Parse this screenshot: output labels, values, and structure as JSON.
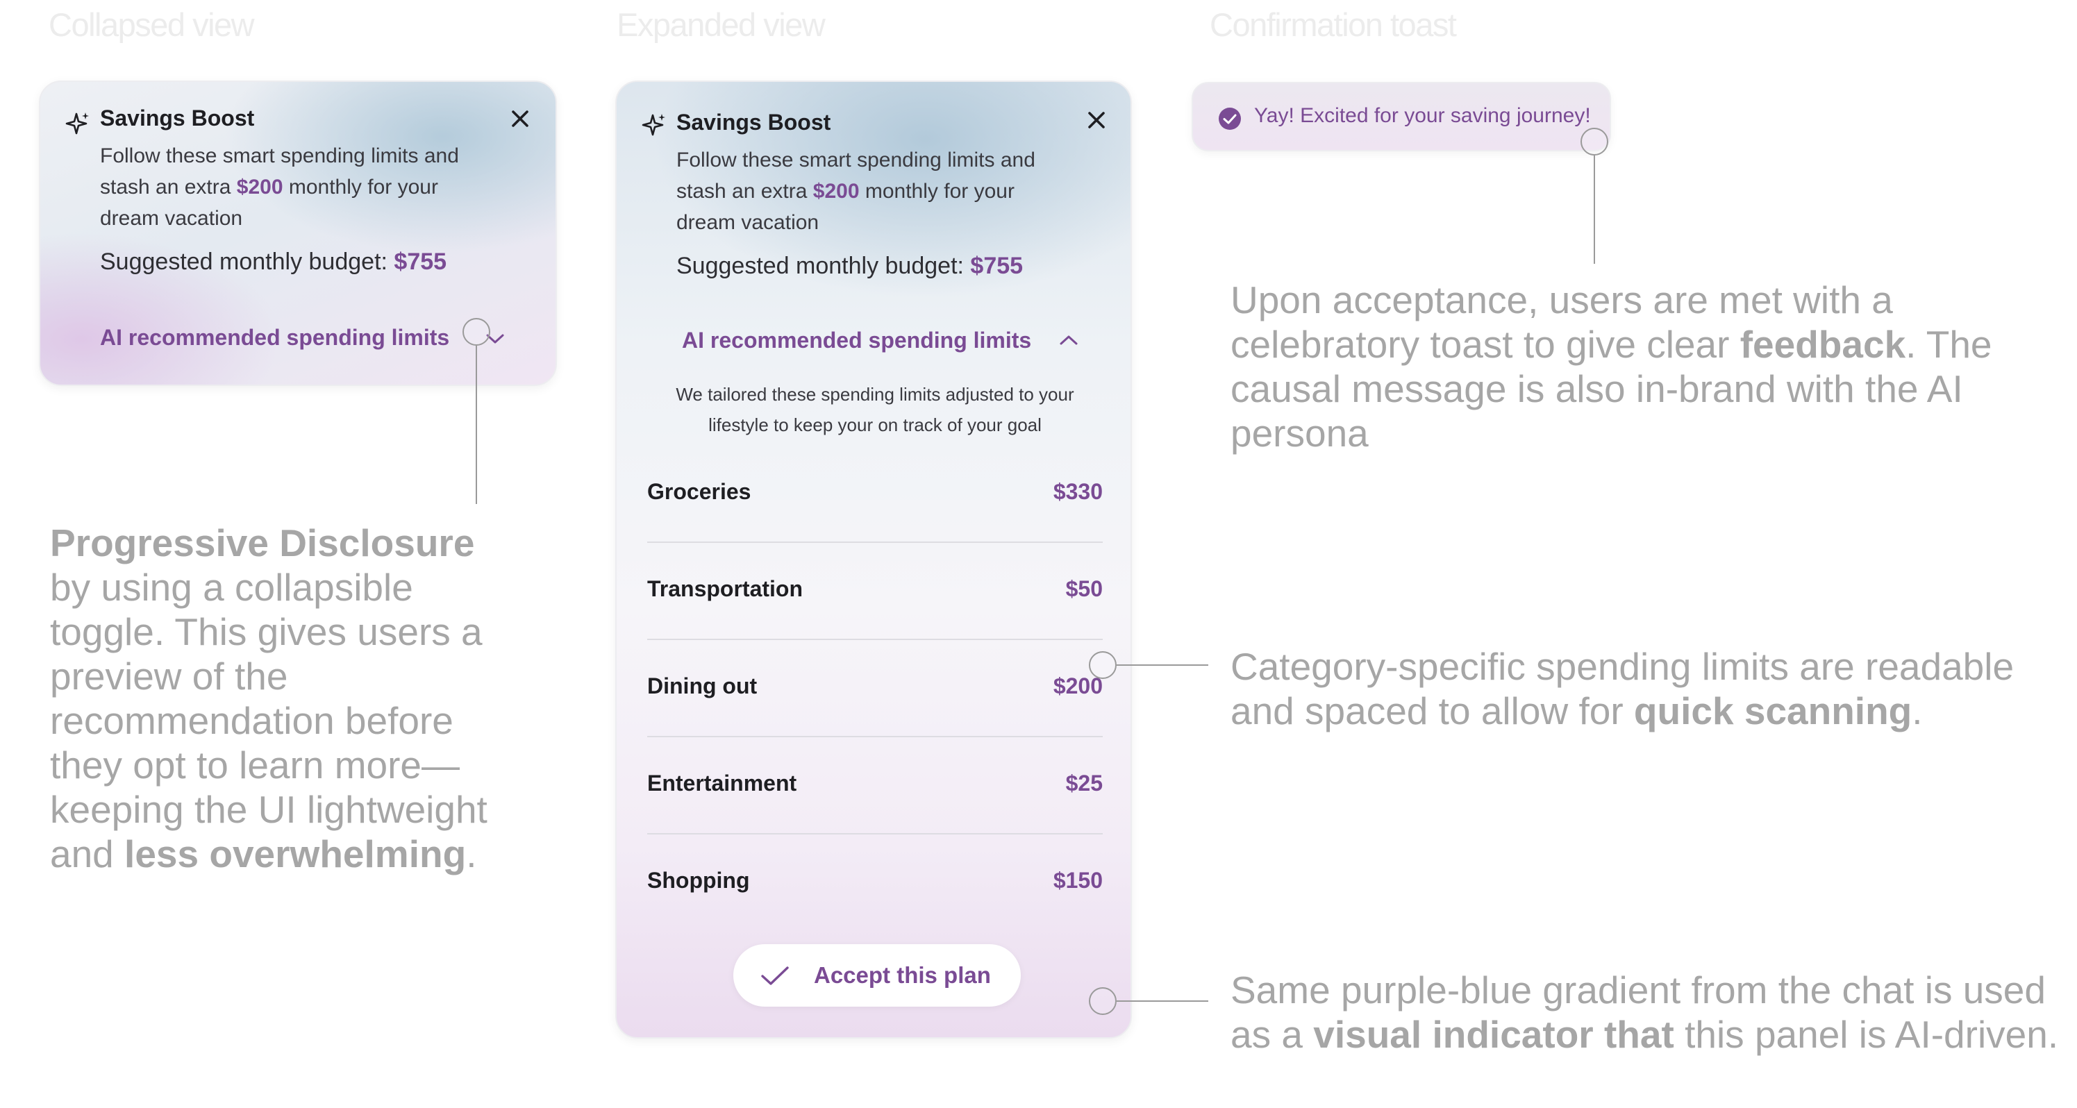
{
  "headings": {
    "collapsed": "Collapsed view",
    "expanded": "Expanded view",
    "toast": "Confirmation toast"
  },
  "card": {
    "title": "Savings Boost",
    "desc_pre": "Follow these smart spending limits and stash an extra ",
    "desc_amount": "$200",
    "desc_post": " monthly for your dream vacation",
    "desc_line1": "Follow these smart spending limits and",
    "desc_line2_a": "stash an extra ",
    "desc_line2_b": " monthly for your",
    "desc_line3": "dream vacation",
    "budget_label": "Suggested monthly budget: ",
    "budget_value": "$755",
    "limits_label": "AI recommended spending limits",
    "tailored_line1": "We tailored these spending limits adjusted to your",
    "tailored_line2": "lifestyle to keep your on track of your goal",
    "categories": [
      {
        "label": "Groceries",
        "value": "$330"
      },
      {
        "label": "Transportation",
        "value": "$50"
      },
      {
        "label": "Dining out",
        "value": "$200"
      },
      {
        "label": "Entertainment",
        "value": "$25"
      },
      {
        "label": "Shopping",
        "value": "$150"
      }
    ],
    "accept_label": "Accept this plan"
  },
  "toast": {
    "text": "Yay! Excited for your saving journey!"
  },
  "annotations": {
    "progressive": {
      "bold1": "Progressive Disclosure",
      "l1": "by using a collapsible",
      "l2": "toggle. This gives users a",
      "l3": "preview of the",
      "l4": "recommendation before",
      "l5": "they opt to learn more—",
      "l6": "keeping the UI lightweight",
      "l7a": "and ",
      "l7b": "less overwhelming",
      "l7c": "."
    },
    "acceptance": {
      "l1": "Upon acceptance, users are met with a",
      "l2a": "celebratory toast to give clear ",
      "l2b": "feedback",
      "l2c": ". The",
      "l3": "causal message is also in-brand with the AI",
      "l4": "persona"
    },
    "category": {
      "l1": "Category-specific spending limits are readable",
      "l2a": "and spaced to allow for ",
      "l2b": "quick scanning",
      "l2c": "."
    },
    "gradient": {
      "l1": "Same purple-blue gradient from the chat is used",
      "l2a": "as a ",
      "l2b": "visual indicator that",
      "l2c": " this panel is AI-driven."
    }
  },
  "icons": {
    "sparkle": "sparkle-icon",
    "close": "close-icon",
    "chevron_down": "chevron-down-icon",
    "chevron_up": "chevron-up-icon",
    "check": "check-icon",
    "check_circle": "check-circle-icon"
  },
  "colors": {
    "accent": "#7a4b94",
    "annotation": "#a6a6a6",
    "heading": "#ececec"
  }
}
